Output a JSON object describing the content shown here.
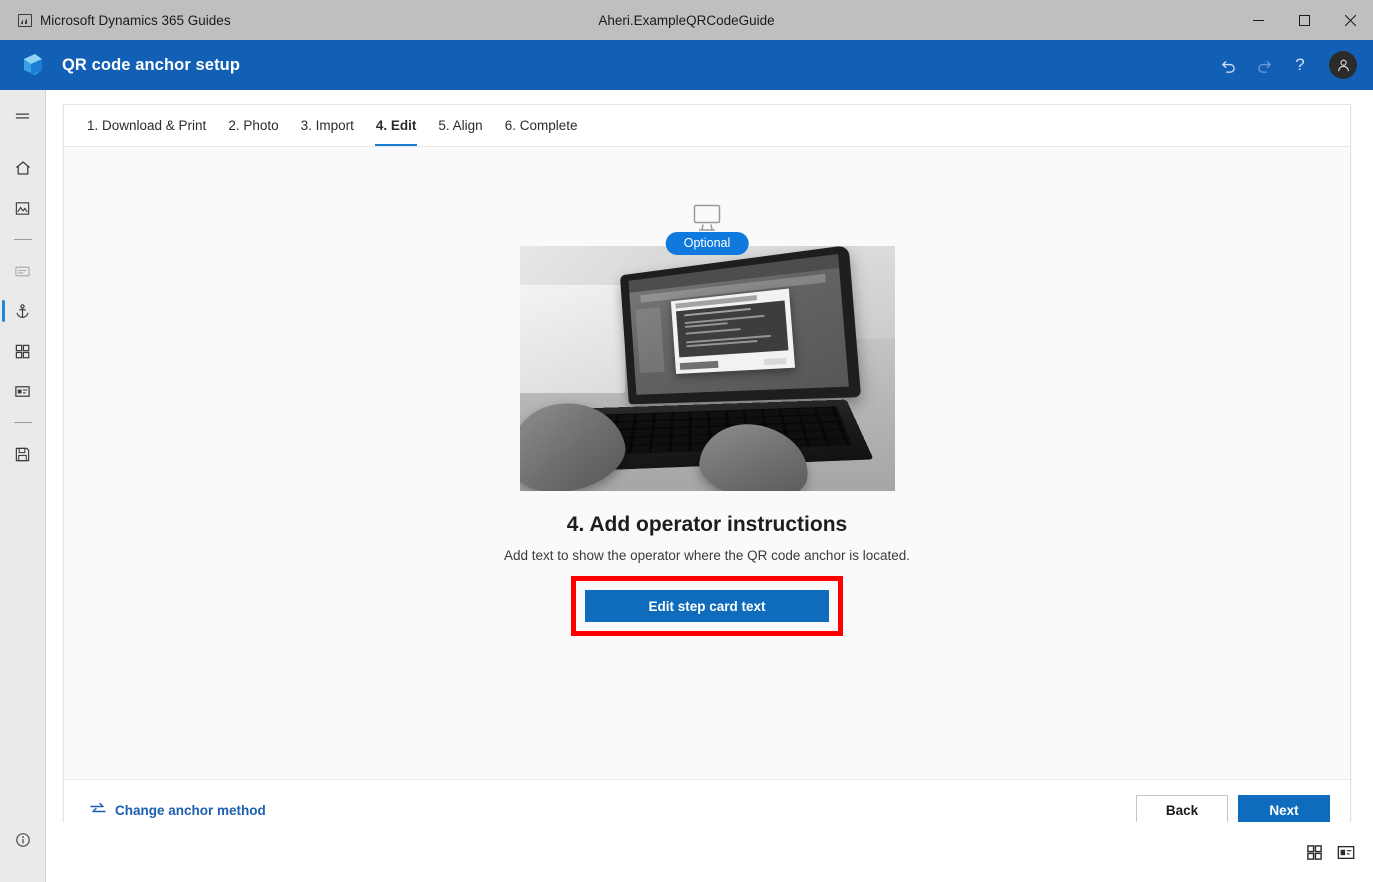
{
  "window": {
    "app_name": "Microsoft Dynamics 365 Guides",
    "document_title": "Aheri.ExampleQRCodeGuide",
    "minimize_label": "Minimize",
    "maximize_label": "Restore",
    "close_label": "Close"
  },
  "appbar": {
    "title": "QR code anchor setup",
    "logo_icon": "dynamics-guides-logo-icon",
    "undo_icon": "undo-icon",
    "redo_icon": "redo-icon",
    "help_label": "?",
    "avatar_icon": "user-avatar-icon"
  },
  "rail": {
    "items": [
      {
        "name": "hamburger-menu",
        "icon": "hamburger-icon",
        "state": "normal"
      },
      {
        "name": "home",
        "icon": "home-icon",
        "state": "normal"
      },
      {
        "name": "media",
        "icon": "image-icon",
        "state": "normal"
      },
      {
        "name": "divider-1",
        "icon": "divider",
        "state": "divider"
      },
      {
        "name": "step-card",
        "icon": "card-icon",
        "state": "faded"
      },
      {
        "name": "anchor",
        "icon": "anchor-icon",
        "state": "selected"
      },
      {
        "name": "apps",
        "icon": "grid-apps-icon",
        "state": "normal"
      },
      {
        "name": "assets",
        "icon": "media-card-icon",
        "state": "normal"
      },
      {
        "name": "divider-2",
        "icon": "divider",
        "state": "divider"
      },
      {
        "name": "save",
        "icon": "save-icon",
        "state": "normal"
      }
    ],
    "info_icon": "info-circle-icon"
  },
  "tabs": [
    {
      "label": "1. Download & Print",
      "active": false
    },
    {
      "label": "2. Photo",
      "active": false
    },
    {
      "label": "3. Import",
      "active": false
    },
    {
      "label": "4. Edit",
      "active": true
    },
    {
      "label": "5. Align",
      "active": false
    },
    {
      "label": "6. Complete",
      "active": false
    }
  ],
  "stage": {
    "device_icon": "desktop-monitor-icon",
    "badge": "Optional",
    "photo_alt": "Hands typing on a laptop showing the QR code anchor dialog",
    "step_title": "4. Add operator instructions",
    "step_description": "Add text to show the operator where the QR code anchor is located.",
    "cta_label": "Edit step card text",
    "highlight_color": "#ff0000"
  },
  "footer": {
    "change_method_label": "Change anchor method",
    "change_method_icon": "swap-arrows-icon",
    "back_label": "Back",
    "next_label": "Next"
  },
  "statusbar": {
    "grid_view_icon": "grid-view-icon",
    "card_view_icon": "card-view-icon"
  },
  "colors": {
    "appbar_blue": "#1260b5",
    "accent_blue": "#0f6cbd",
    "badge_blue": "#0f79dd",
    "tab_underline": "#1b7fd4",
    "rail_selected": "#1b8ae0",
    "link_blue": "#1b5fb0",
    "titlebar_gray": "#bfbfbf",
    "stage_bg": "#fafafa"
  }
}
